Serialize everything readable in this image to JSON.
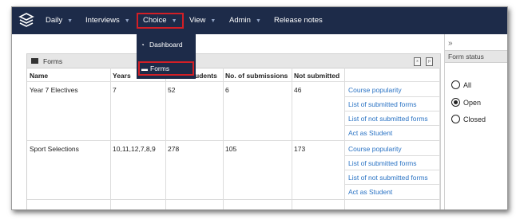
{
  "nav": {
    "items": [
      {
        "label": "Daily",
        "caret": "▼"
      },
      {
        "label": "Interviews",
        "caret": "▼"
      },
      {
        "label": "Choice",
        "caret": "▼"
      },
      {
        "label": "View",
        "caret": "▼"
      },
      {
        "label": "Admin",
        "caret": "▼"
      },
      {
        "label": "Release notes"
      }
    ]
  },
  "dropdown": {
    "items": [
      {
        "label": "Dashboard",
        "icon": "dashboard-icon"
      },
      {
        "label": "Forms",
        "icon": "table-icon"
      }
    ]
  },
  "sidebar": {
    "chevron": "»",
    "title": "Form status",
    "options": [
      {
        "label": "All",
        "selected": false
      },
      {
        "label": "Open",
        "selected": true
      },
      {
        "label": "Closed",
        "selected": false
      }
    ]
  },
  "forms": {
    "title": "Forms",
    "columns": [
      "Name",
      "Years",
      "No. of students",
      "No. of submissions",
      "Not submitted"
    ],
    "rows": [
      {
        "name": "Year 7 Electives",
        "years": "7",
        "students": "52",
        "submissions": "6",
        "not_submitted": "46",
        "actions": [
          "Course popularity",
          "List of submitted forms",
          "List of not submitted forms",
          "Act as Student"
        ]
      },
      {
        "name": "Sport Selections",
        "years": "10,11,12,7,8,9",
        "students": "278",
        "submissions": "105",
        "not_submitted": "173",
        "actions": [
          "Course popularity",
          "List of submitted forms",
          "List of not submitted forms",
          "Act as Student"
        ]
      }
    ]
  }
}
